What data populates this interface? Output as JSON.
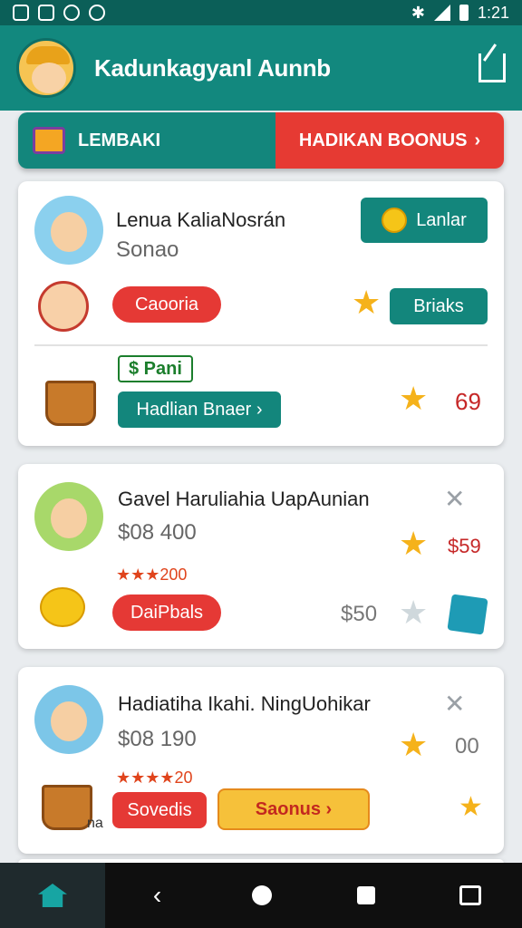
{
  "status": {
    "time": "1:21"
  },
  "app": {
    "title": "Kadunkagyanl Aunnb"
  },
  "tabs": {
    "left": "LEMBAKI",
    "right": "HADIKAN BOONUS",
    "right_icon": "›"
  },
  "cards": [
    {
      "title": "Lenua KaliaNosrán",
      "subtitle": "Sonao",
      "tag_button": "Lanlar",
      "pill_red": "Caooria",
      "pill_teal": "Briaks",
      "green_tag": "$ Pani",
      "action_button": "Hadlian Bnaer ›",
      "number": "69"
    },
    {
      "title": "Gavel Haruliahia UapAunian",
      "price": "$08 400",
      "rating": "★★★200",
      "pill_red": "DaiPbals",
      "right_price": "$59",
      "bottom_price": "$50",
      "close": "✕"
    },
    {
      "title": "Hadiatiha Ikahi. NingUohikar",
      "price": "$08 190",
      "rating": "★★★★20",
      "pill_red": "Sovedis",
      "yellow_button": "Saonus ›",
      "right_num": "00",
      "small_text": "na",
      "close": "✕"
    }
  ],
  "icons": [
    "share-icon",
    "gift-icon",
    "coin-icon",
    "star-icon",
    "home-icon",
    "back-icon",
    "circle-icon",
    "square-icon",
    "bag-icon"
  ]
}
